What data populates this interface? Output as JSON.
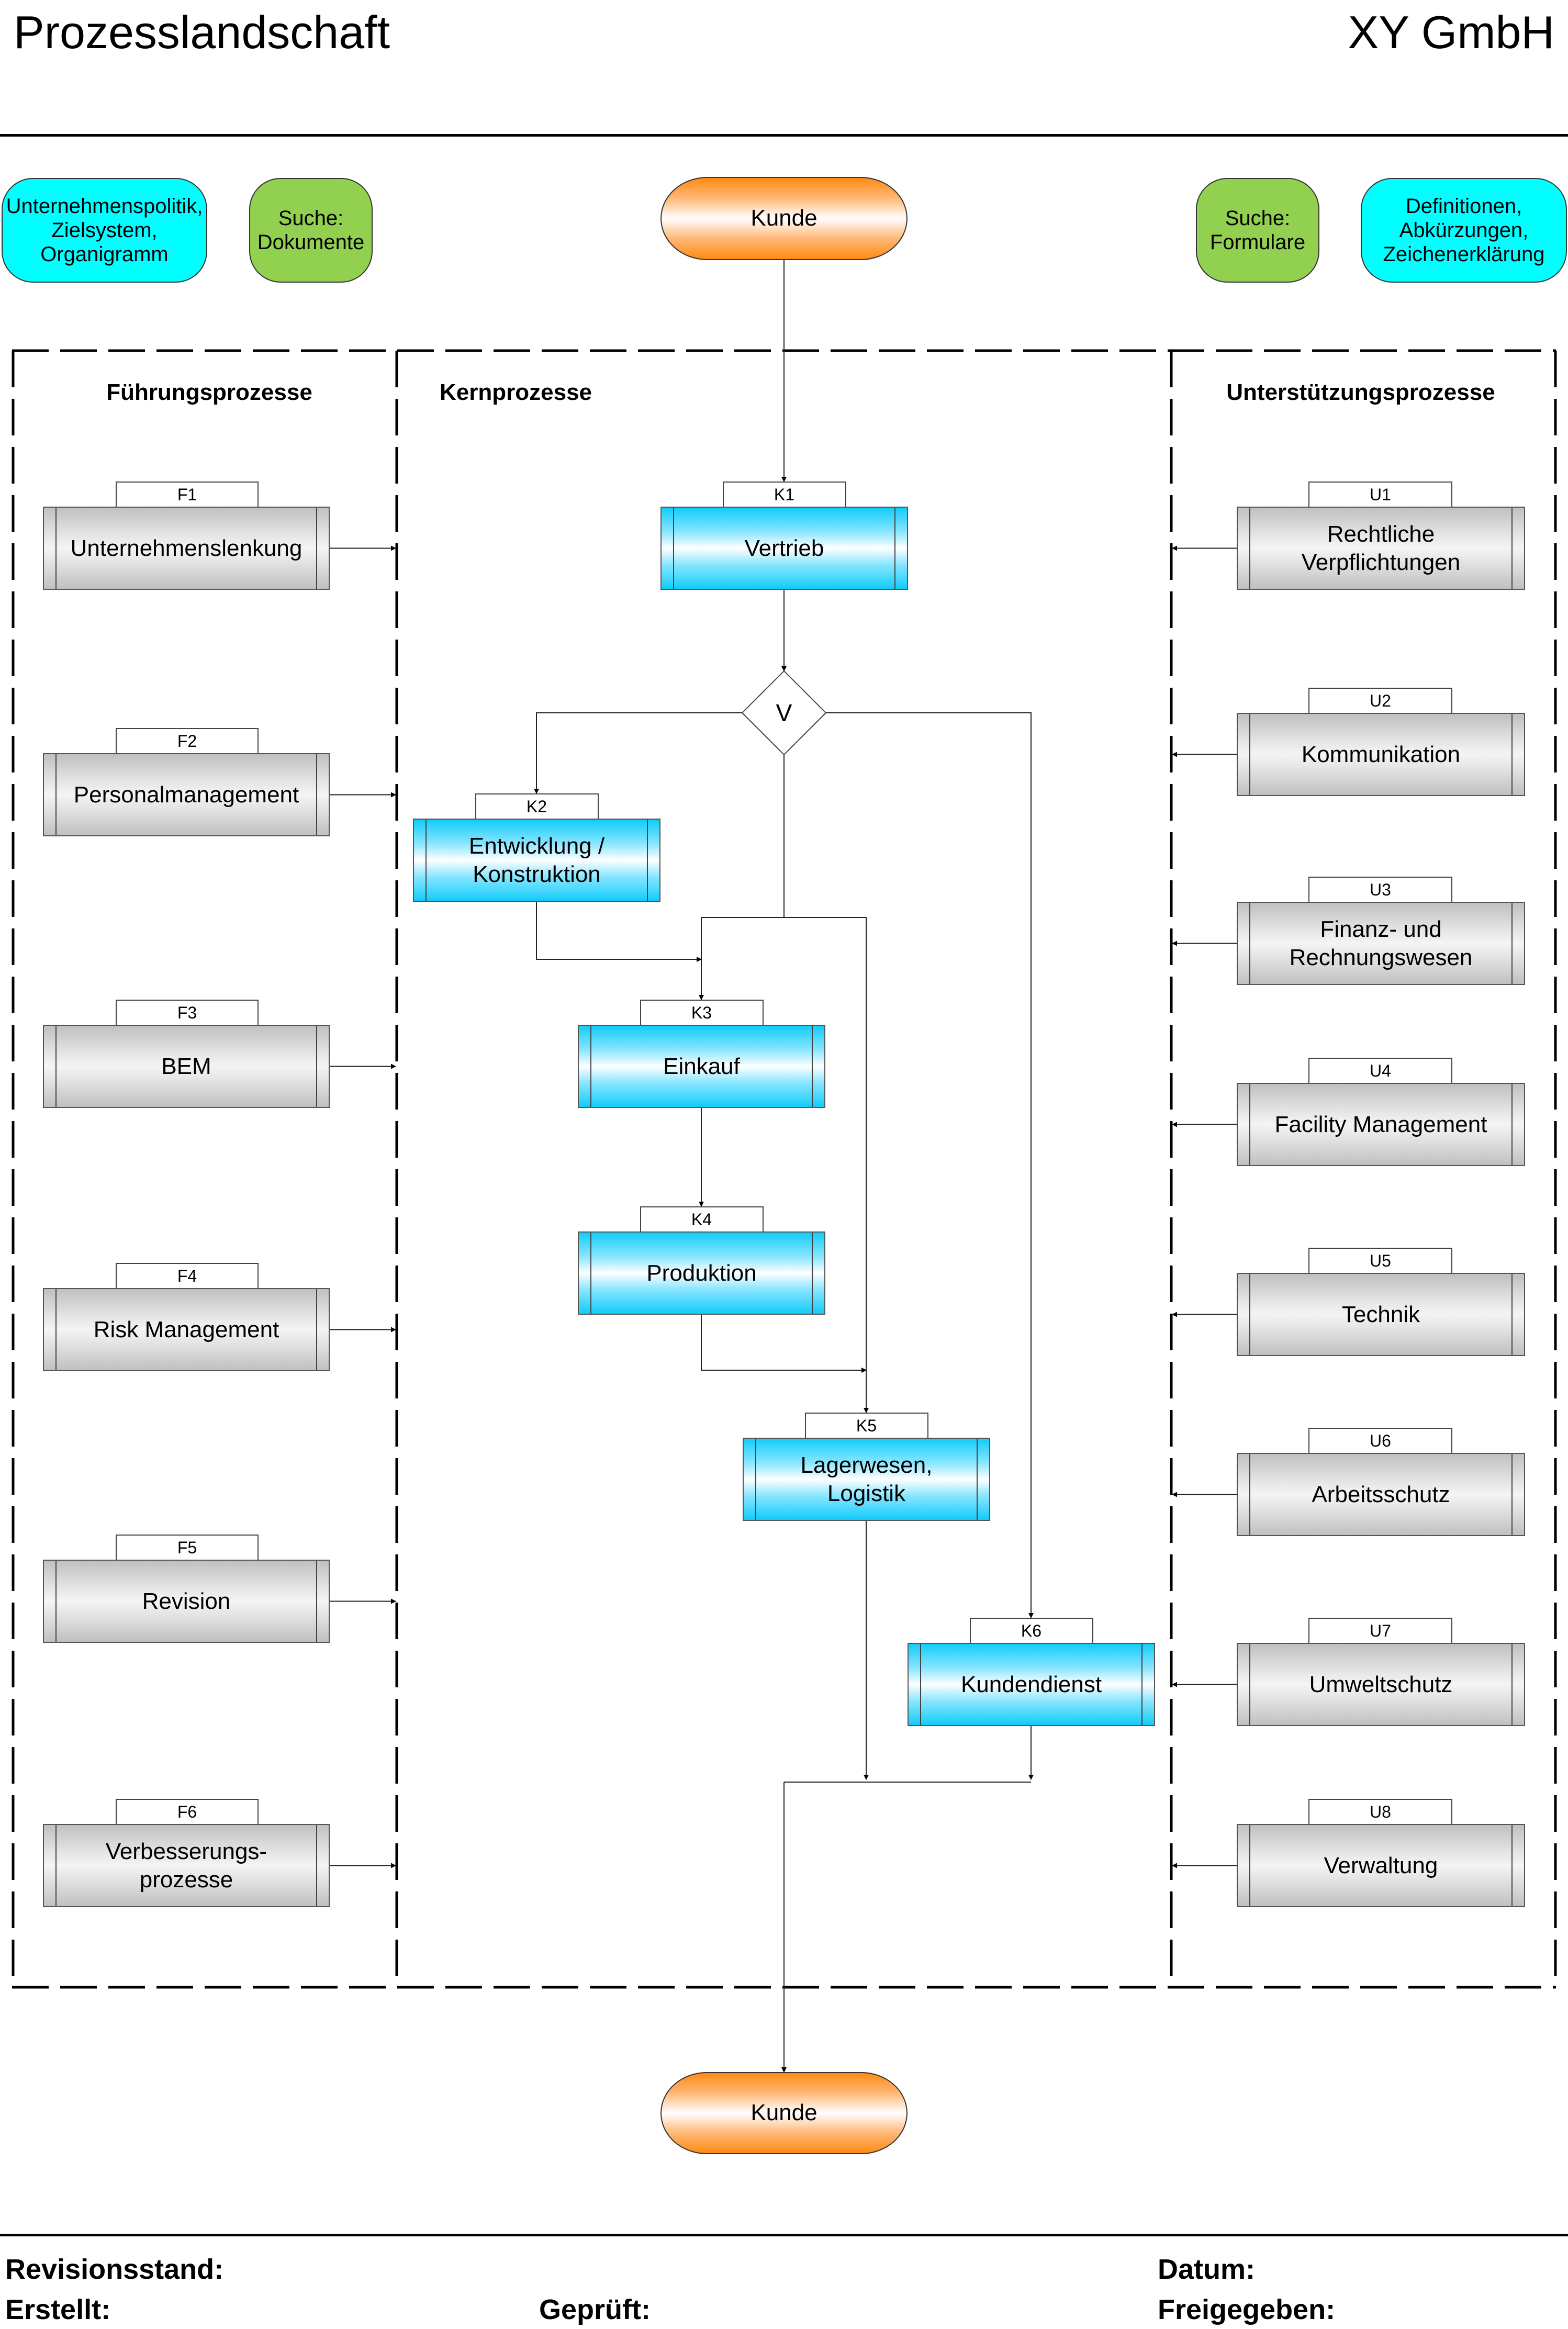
{
  "header": {
    "title": "Prozesslandschaft",
    "company": "XY GmbH"
  },
  "top_links": [
    {
      "id": "unternehmenspolitik",
      "label": "Unternehmenspolitik,\nZielsystem,\nOrganigramm",
      "color": "#00ffff"
    },
    {
      "id": "suche-dokumente",
      "label": "Suche:\nDokumente",
      "color": "#92d050"
    },
    {
      "id": "suche-formulare",
      "label": "Suche:\nFormulare",
      "color": "#92d050"
    },
    {
      "id": "definitionen",
      "label": "Definitionen,\nAbkürzungen,\nZeichenerklärung",
      "color": "#00ffff"
    }
  ],
  "customer": {
    "top_label": "Kunde",
    "bottom_label": "Kunde",
    "color": "#ff8a14"
  },
  "columns": {
    "fuehrung": {
      "title": "Führungsprozesse"
    },
    "kern": {
      "title": "Kernprozesse"
    },
    "unterstuetzung": {
      "title": "Unterstützungsprozesse"
    }
  },
  "fuehrung_items": [
    {
      "code": "F1",
      "label": "Unternehmenslenkung"
    },
    {
      "code": "F2",
      "label": "Personalmanagement"
    },
    {
      "code": "F3",
      "label": "BEM"
    },
    {
      "code": "F4",
      "label": "Risk Management"
    },
    {
      "code": "F5",
      "label": "Revision"
    },
    {
      "code": "F6",
      "label": "Verbesserungs-\nprozesse"
    }
  ],
  "kern_items": [
    {
      "code": "K1",
      "label": "Vertrieb"
    },
    {
      "code": "K2",
      "label": "Entwicklung /\nKonstruktion"
    },
    {
      "code": "K3",
      "label": "Einkauf"
    },
    {
      "code": "K4",
      "label": "Produktion"
    },
    {
      "code": "K5",
      "label": "Lagerwesen,\nLogistik"
    },
    {
      "code": "K6",
      "label": "Kundendienst"
    }
  ],
  "decision": {
    "label": "V"
  },
  "unterstuetzung_items": [
    {
      "code": "U1",
      "label": "Rechtliche\nVerpflichtungen"
    },
    {
      "code": "U2",
      "label": "Kommunikation"
    },
    {
      "code": "U3",
      "label": "Finanz- und\nRechnungswesen"
    },
    {
      "code": "U4",
      "label": "Facility Management"
    },
    {
      "code": "U5",
      "label": "Technik"
    },
    {
      "code": "U6",
      "label": "Arbeitsschutz"
    },
    {
      "code": "U7",
      "label": "Umweltschutz"
    },
    {
      "code": "U8",
      "label": "Verwaltung"
    }
  ],
  "footer": {
    "revision": "Revisionsstand:",
    "datum": "Datum:",
    "erstellt": "Erstellt:",
    "geprueft": "Geprüft:",
    "freigegeben": "Freigegeben:"
  },
  "colors": {
    "core_process": "#12ccfa",
    "support_process": "#c0c0c0",
    "link_cyan": "#00ffff",
    "link_green": "#92d050"
  }
}
